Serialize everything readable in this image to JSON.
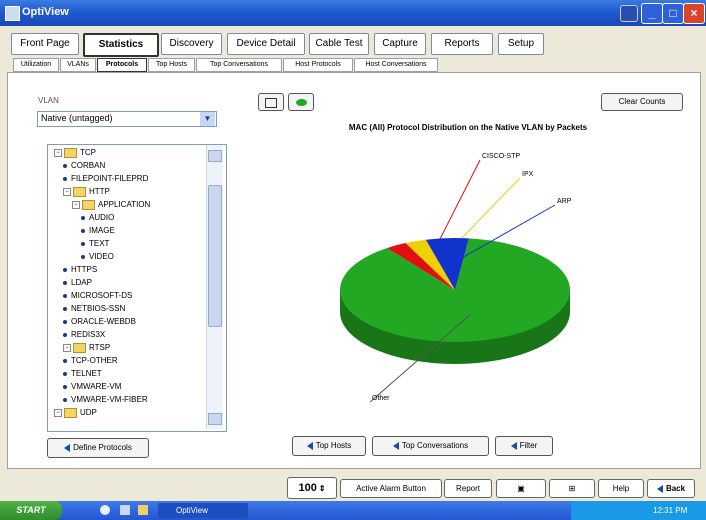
{
  "window": {
    "title": "OptiView",
    "colors": {
      "titlebar": "#1f5bd1",
      "pie_main": "#22a822",
      "pie_blue": "#1033cc",
      "pie_red": "#e01010",
      "pie_yellow": "#f0d000"
    }
  },
  "toolbar": {
    "tabs": [
      "Front Page",
      "Statistics",
      "Discovery",
      "Device Detail",
      "Cable Test",
      "Capture",
      "Reports",
      "Setup"
    ],
    "active": "Statistics"
  },
  "subtabs": {
    "tabs": [
      "Utilization",
      "VLANs",
      "Protocols",
      "Top Hosts",
      "Top Conversations",
      "Host Protocols",
      "Host Conversations"
    ],
    "active": "Protocols"
  },
  "left": {
    "vlan_label": "VLAN",
    "vlan_value": "Native (untagged)",
    "tree": [
      {
        "type": "folder",
        "label": "TCP",
        "indent": 0
      },
      {
        "type": "leaf",
        "label": "CORBAN",
        "indent": 1
      },
      {
        "type": "leaf",
        "label": "FILEPOINT-FILEPRD",
        "indent": 1
      },
      {
        "type": "folder",
        "label": "HTTP",
        "indent": 1
      },
      {
        "type": "folder",
        "label": "APPLICATION",
        "indent": 2
      },
      {
        "type": "leaf",
        "label": "AUDIO",
        "indent": 3
      },
      {
        "type": "leaf",
        "label": "IMAGE",
        "indent": 3
      },
      {
        "type": "leaf",
        "label": "TEXT",
        "indent": 3
      },
      {
        "type": "leaf",
        "label": "VIDEO",
        "indent": 3
      },
      {
        "type": "leaf",
        "label": "HTTPS",
        "indent": 1
      },
      {
        "type": "leaf",
        "label": "LDAP",
        "indent": 1
      },
      {
        "type": "leaf",
        "label": "MICROSOFT-DS",
        "indent": 1
      },
      {
        "type": "leaf",
        "label": "NETBIOS-SSN",
        "indent": 1
      },
      {
        "type": "leaf",
        "label": "ORACLE-WEBDB",
        "indent": 1
      },
      {
        "type": "leaf",
        "label": "REDIS3X",
        "indent": 1
      },
      {
        "type": "folder",
        "label": "RTSP",
        "indent": 1
      },
      {
        "type": "leaf",
        "label": "TCP-OTHER",
        "indent": 1
      },
      {
        "type": "leaf",
        "label": "TELNET",
        "indent": 1
      },
      {
        "type": "leaf",
        "label": "VMWARE-VM",
        "indent": 1
      },
      {
        "type": "leaf",
        "label": "VMWARE-VM-FIBER",
        "indent": 1
      },
      {
        "type": "folder",
        "label": "UDP",
        "indent": 0
      }
    ],
    "define_button": "Define Protocols"
  },
  "chart_panel": {
    "clear_counts": "Clear Counts",
    "view_icons": [
      "table-view-icon",
      "pie-view-icon"
    ],
    "top_hosts": "Top Hosts",
    "top_conversations": "Top Conversations",
    "filter": "Filter"
  },
  "chart_data": {
    "type": "pie",
    "title": "MAC (All) Protocol Distribution on the Native VLAN by Packets",
    "slices": [
      {
        "label": "Other",
        "value": 88
      },
      {
        "label": "CISCO-STP",
        "value": 3
      },
      {
        "label": "IPX",
        "value": 3
      },
      {
        "label": "ARP",
        "value": 6
      }
    ],
    "colors": [
      "#22a822",
      "#e01010",
      "#f0d000",
      "#1033cc"
    ]
  },
  "bottom": {
    "zoom": "100",
    "buttons": [
      "Active Alarm Button",
      "Report"
    ],
    "help": "Help",
    "back": "Back"
  },
  "taskbar": {
    "start": "START",
    "app": "OptiView",
    "clock": "12:31 PM"
  }
}
